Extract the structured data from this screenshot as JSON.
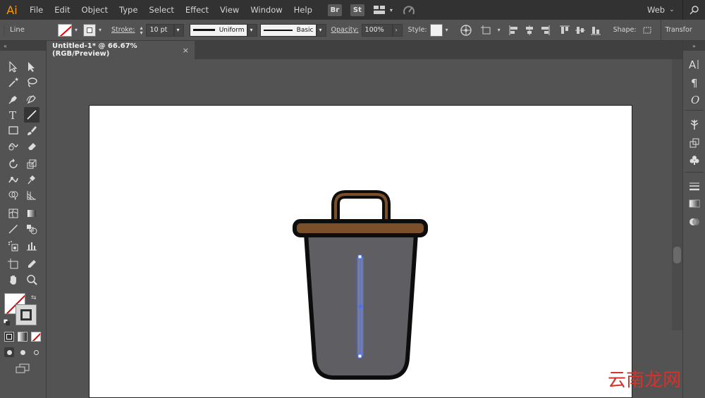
{
  "app": {
    "logo_text": "Ai"
  },
  "menubar": {
    "items": [
      "File",
      "Edit",
      "Object",
      "Type",
      "Select",
      "Effect",
      "View",
      "Window",
      "Help"
    ],
    "bridge_label": "Br",
    "stock_label": "St",
    "workspace": "Web"
  },
  "controlbar": {
    "selection_type": "Line",
    "stroke_label": "Stroke:",
    "stroke_weight": "10 pt",
    "profile_label": "Uniform",
    "brush_label": "Basic",
    "opacity_label": "Opacity:",
    "opacity_value": "100%",
    "style_label": "Style:",
    "shape_label": "Shape:",
    "transform_label": "Transfor"
  },
  "document": {
    "tab_title": "Untitled-1* @ 66.67% (RGB/Preview)",
    "close_glyph": "×"
  },
  "colors": {
    "trash_body": "#5f5f63",
    "trash_lid": "#7a4f2a",
    "outline": "#0d0d0d",
    "selection": "#4a6cf7",
    "accent_logo": "#ff9a00"
  },
  "icons": {
    "toolbar": [
      "selection-icon",
      "direct-selection-icon",
      "magic-wand-icon",
      "lasso-icon",
      "pen-icon",
      "curvature-icon",
      "type-icon",
      "line-segment-icon",
      "rectangle-icon",
      "paintbrush-icon",
      "shaper-icon",
      "eraser-icon",
      "rotate-icon",
      "scale-icon",
      "warp-icon",
      "free-transform-icon",
      "shape-builder-icon",
      "perspective-grid-icon",
      "mesh-icon",
      "gradient-icon",
      "eyedropper-icon",
      "blend-icon",
      "symbol-sprayer-icon",
      "column-graph-icon",
      "artboard-icon",
      "slice-icon",
      "hand-icon",
      "zoom-icon"
    ]
  },
  "watermark": {
    "text": "云南龙网"
  }
}
